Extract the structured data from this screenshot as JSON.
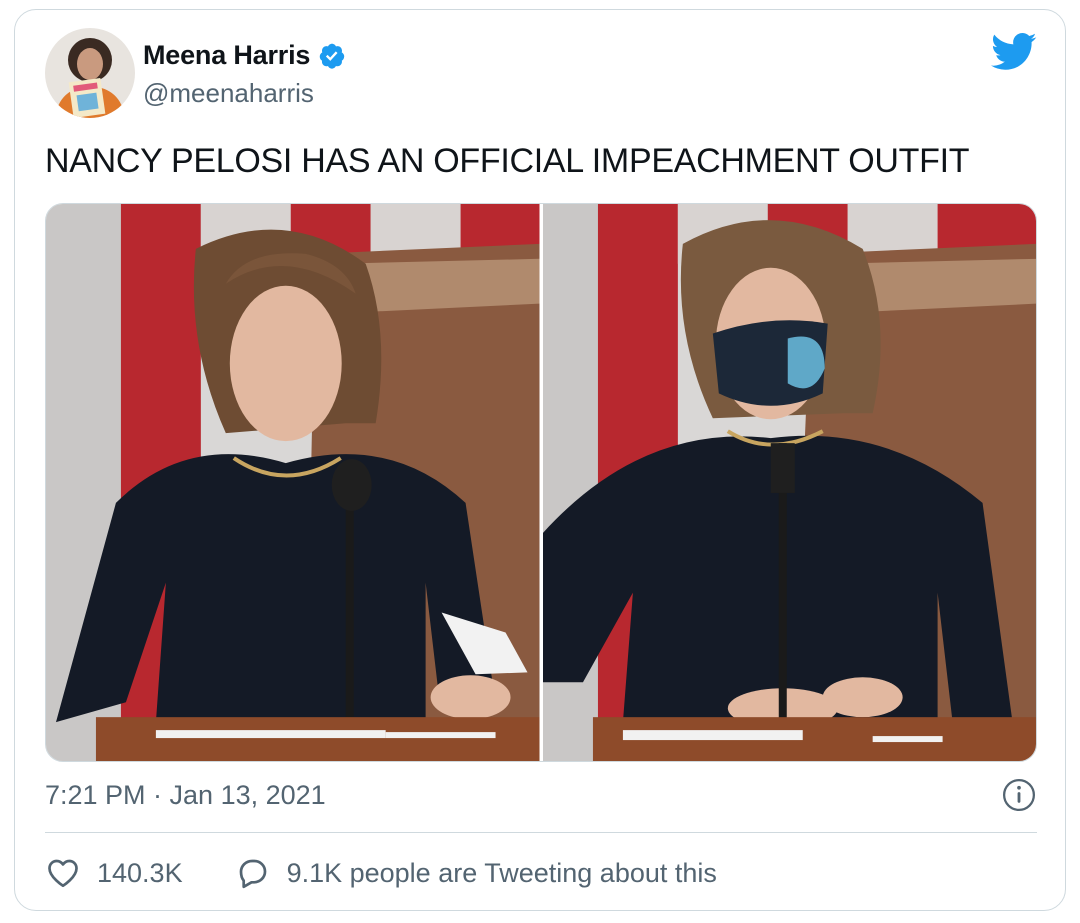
{
  "author": {
    "display_name": "Meena Harris",
    "handle": "@meenaharris",
    "verified": true,
    "avatar_icon": "profile-photo"
  },
  "tweet": {
    "text": "NANCY PELOSI HAS AN OFFICIAL IMPEACHMENT OUTFIT"
  },
  "media": {
    "photos": [
      {
        "icon": "photo-pelosi-unmasked"
      },
      {
        "icon": "photo-pelosi-masked"
      }
    ]
  },
  "meta": {
    "timestamp": "7:21 PM · Jan 13, 2021"
  },
  "actions": {
    "likes": "140.3K",
    "conversation": "9.1K people are Tweeting about this"
  },
  "colors": {
    "brand_blue": "#1d9bf0",
    "text_primary": "#0f1419",
    "text_secondary": "#536471",
    "border": "#cfd9de"
  }
}
